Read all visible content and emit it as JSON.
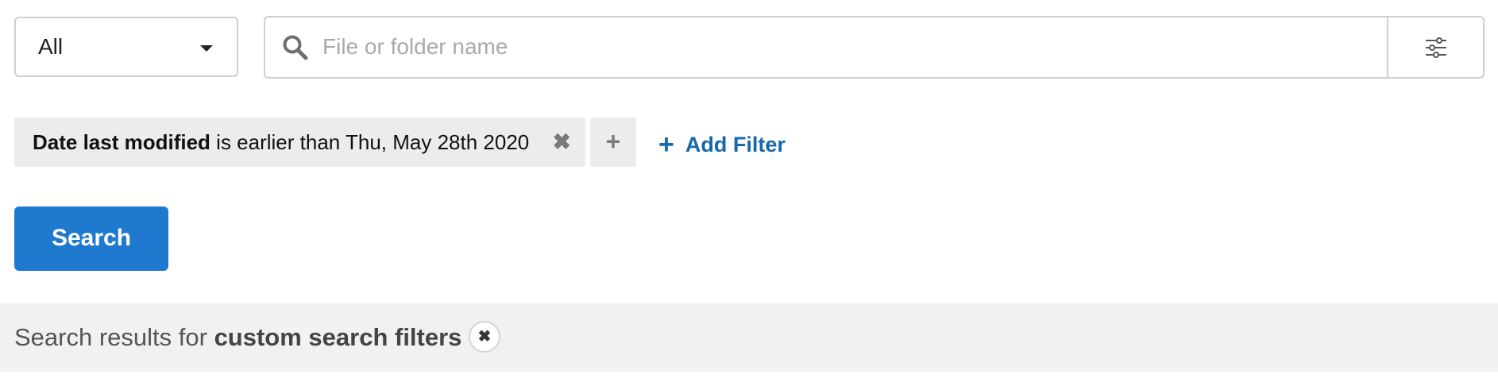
{
  "scope_select": {
    "value": "All"
  },
  "search": {
    "placeholder": "File or folder name",
    "value": ""
  },
  "filters": [
    {
      "field": "Date last modified",
      "condition": "is earlier than Thu, May 28th 2020",
      "remove_glyph": "✖"
    }
  ],
  "filter_group_add": {
    "glyph": "+"
  },
  "add_filter": {
    "glyph": "+",
    "label": "Add Filter"
  },
  "search_button": {
    "label": "Search"
  },
  "results": {
    "prefix": "Search results for",
    "query": "custom search filters",
    "clear_glyph": "✖"
  },
  "colors": {
    "accent": "#1e79cf",
    "link": "#1769ad",
    "chip_bg": "#ececec",
    "results_bg": "#f0f1f2"
  },
  "icons": [
    "chevron-down-icon",
    "search-icon",
    "sliders-icon",
    "close-icon",
    "plus-icon"
  ]
}
